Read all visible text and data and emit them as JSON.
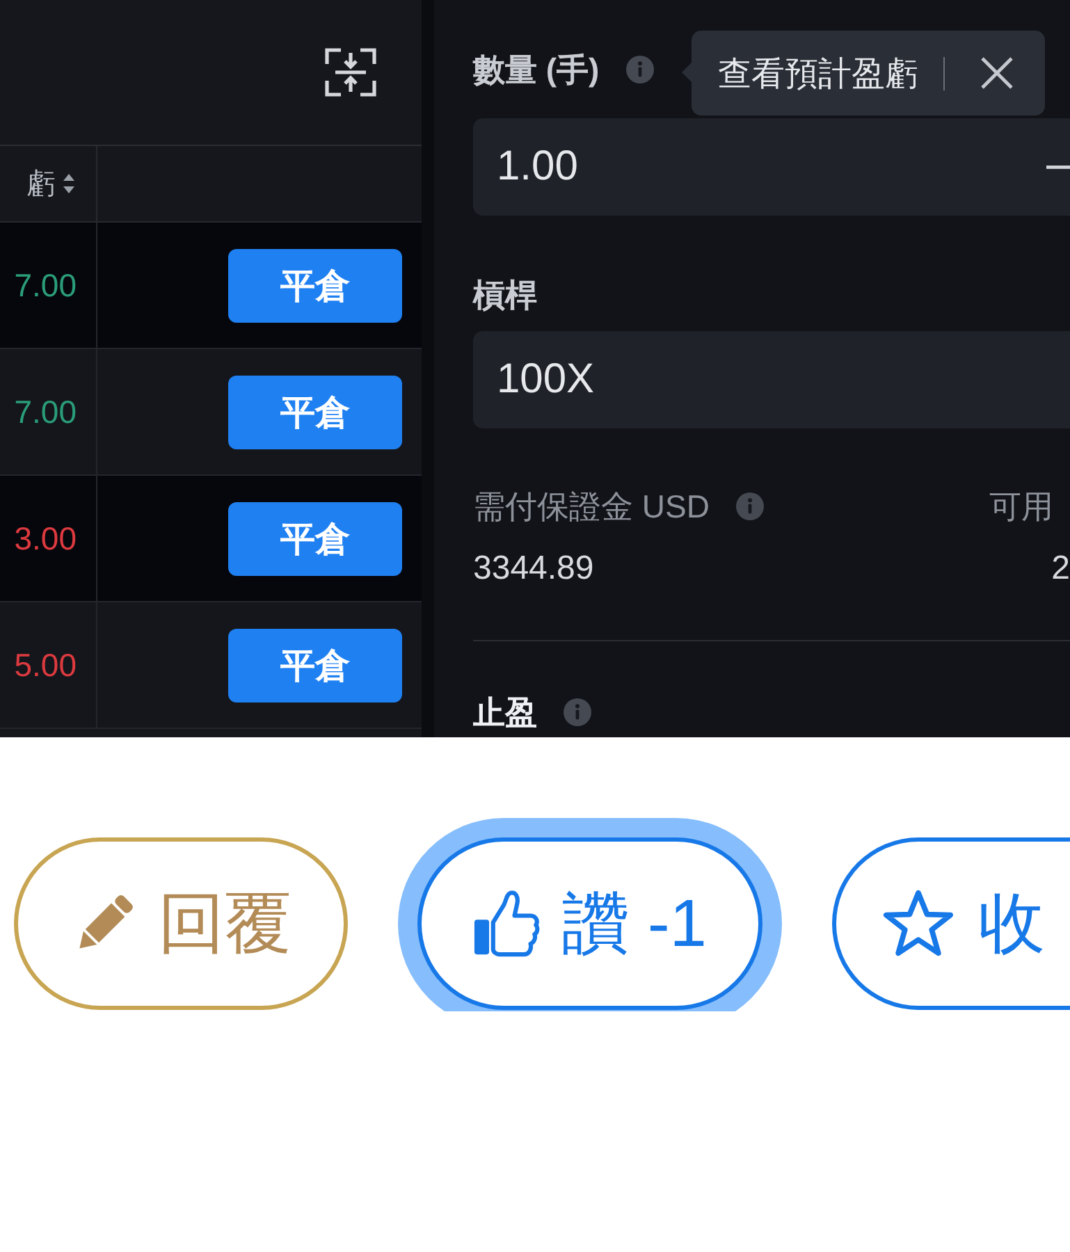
{
  "positions": {
    "header": {
      "label": "虧",
      "sortable": true
    },
    "rows": [
      {
        "pnl": "7.00",
        "color": "#2a9d78",
        "action": "平倉"
      },
      {
        "pnl": "7.00",
        "color": "#2a9d78",
        "action": "平倉"
      },
      {
        "pnl": "3.00",
        "color": "#dc3a3f",
        "action": "平倉"
      },
      {
        "pnl": "5.00",
        "color": "#dc3a3f",
        "action": "平倉"
      }
    ]
  },
  "order_form": {
    "quantity": {
      "label": "數量 (手)",
      "value": "1.00",
      "tooltip": "查看預計盈虧"
    },
    "leverage": {
      "label": "槓桿",
      "value": "100X"
    },
    "margin": {
      "label": "需付保證金 USD",
      "value": "3344.89"
    },
    "available": {
      "label": "可用",
      "value": "2"
    },
    "take_profit": {
      "label": "止盈"
    }
  },
  "actions": [
    {
      "kind": "reply",
      "label": "回覆",
      "focused": false
    },
    {
      "kind": "like",
      "label": "讚 -1",
      "focused": true
    },
    {
      "kind": "favorite",
      "label": "收",
      "focused": false
    }
  ]
}
